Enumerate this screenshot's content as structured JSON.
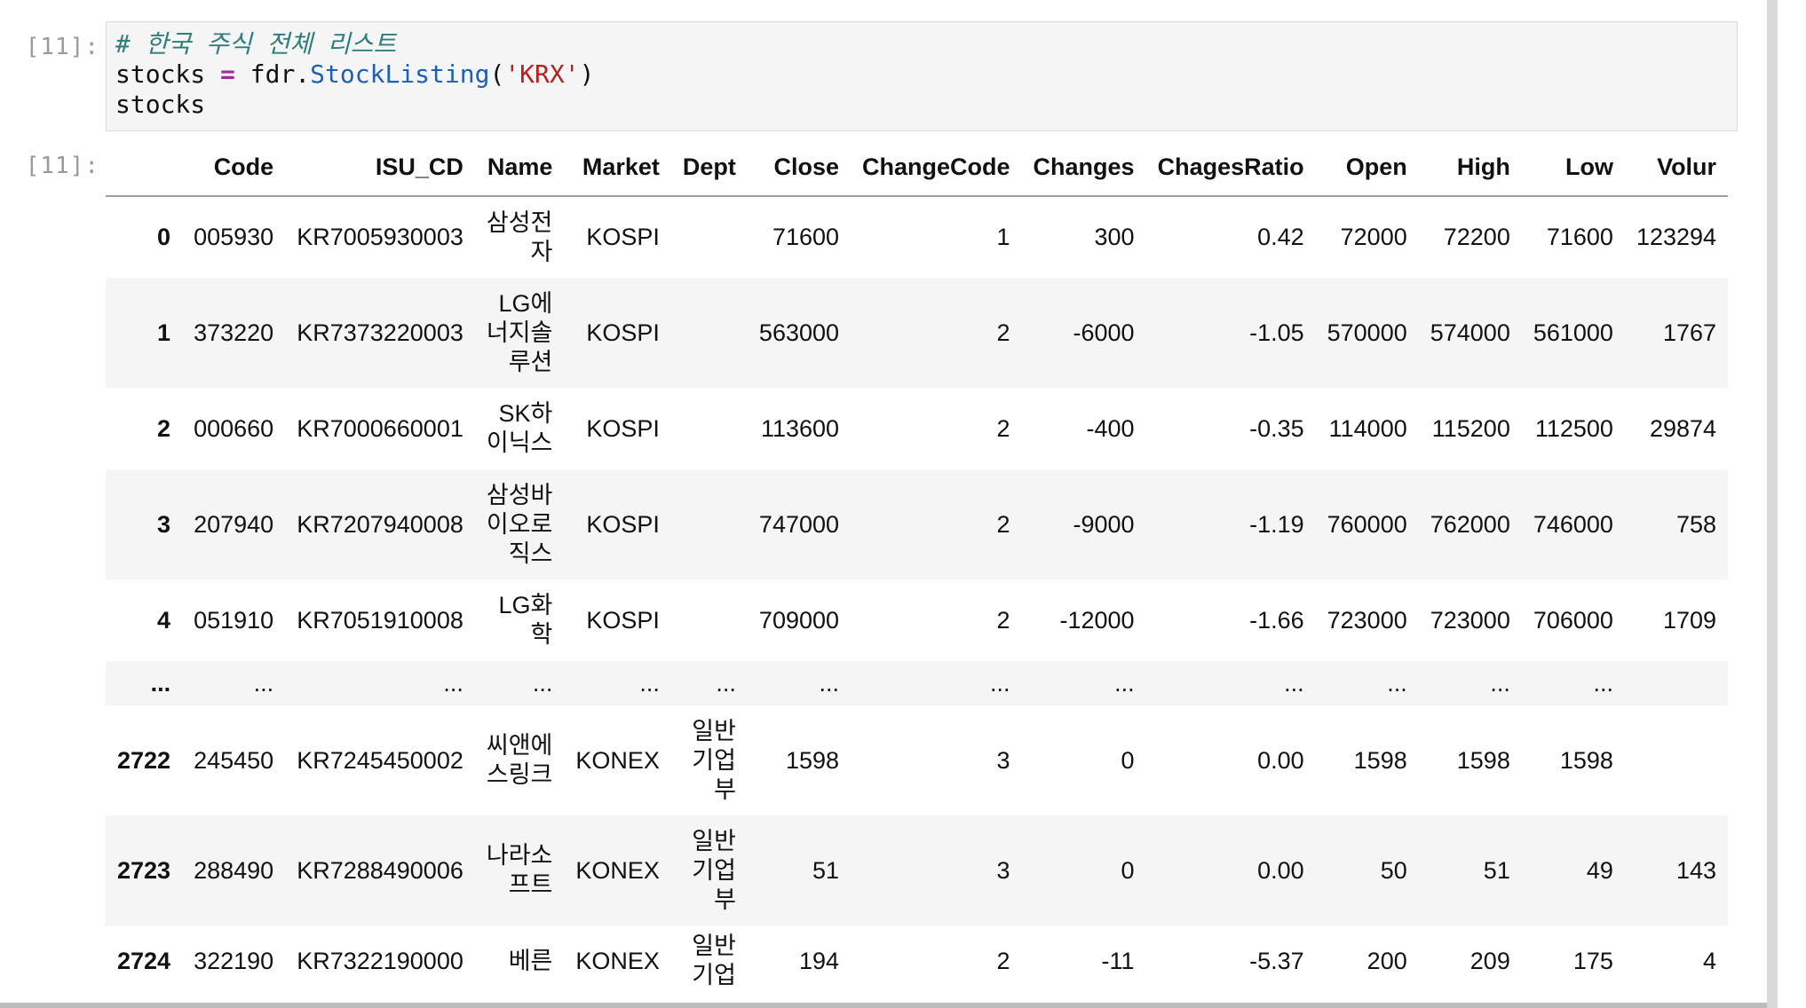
{
  "input_prompt": "[11]:",
  "output_prompt": "[11]:",
  "code_lines": [
    [
      {
        "cls": "c-comment",
        "t": "# 한국 주식 전체 리스트"
      }
    ],
    [
      {
        "cls": "c-name",
        "t": "stocks "
      },
      {
        "cls": "c-op",
        "t": "="
      },
      {
        "cls": "c-name",
        "t": " fdr."
      },
      {
        "cls": "c-func",
        "t": "StockListing"
      },
      {
        "cls": "c-name",
        "t": "("
      },
      {
        "cls": "c-str",
        "t": "'KRX'"
      },
      {
        "cls": "c-name",
        "t": ")"
      }
    ],
    [
      {
        "cls": "c-name",
        "t": "stocks"
      }
    ]
  ],
  "table": {
    "columns": [
      "",
      "Code",
      "ISU_CD",
      "Name",
      "Market",
      "Dept",
      "Close",
      "ChangeCode",
      "Changes",
      "ChagesRatio",
      "Open",
      "High",
      "Low",
      "Volur"
    ],
    "rows": [
      {
        "idx": "0",
        "cells": [
          "005930",
          "KR7005930003",
          [
            "삼성전",
            "자"
          ],
          "KOSPI",
          "",
          "71600",
          "1",
          "300",
          "0.42",
          "72000",
          "72200",
          "71600",
          "123294"
        ]
      },
      {
        "idx": "1",
        "cells": [
          "373220",
          "KR7373220003",
          [
            "LG에",
            "너지솔",
            "루션"
          ],
          "KOSPI",
          "",
          "563000",
          "2",
          "-6000",
          "-1.05",
          "570000",
          "574000",
          "561000",
          "1767"
        ]
      },
      {
        "idx": "2",
        "cells": [
          "000660",
          "KR7000660001",
          [
            "SK하",
            "이닉스"
          ],
          "KOSPI",
          "",
          "113600",
          "2",
          "-400",
          "-0.35",
          "114000",
          "115200",
          "112500",
          "29874"
        ]
      },
      {
        "idx": "3",
        "cells": [
          "207940",
          "KR7207940008",
          [
            "삼성바",
            "이오로",
            "직스"
          ],
          "KOSPI",
          "",
          "747000",
          "2",
          "-9000",
          "-1.19",
          "760000",
          "762000",
          "746000",
          "758"
        ]
      },
      {
        "idx": "4",
        "cells": [
          "051910",
          "KR7051910008",
          [
            "LG화",
            "학"
          ],
          "KOSPI",
          "",
          "709000",
          "2",
          "-12000",
          "-1.66",
          "723000",
          "723000",
          "706000",
          "1709"
        ]
      },
      {
        "idx": "...",
        "cells": [
          "...",
          "...",
          [
            "..."
          ],
          "...",
          "...",
          "...",
          "...",
          "...",
          "...",
          "...",
          "...",
          "...",
          ""
        ]
      },
      {
        "idx": "2722",
        "cells": [
          "245450",
          "KR7245450002",
          [
            "씨앤에",
            "스링크"
          ],
          "KONEX",
          [
            "일반",
            "기업",
            "부"
          ],
          "1598",
          "3",
          "0",
          "0.00",
          "1598",
          "1598",
          "1598",
          ""
        ]
      },
      {
        "idx": "2723",
        "cells": [
          "288490",
          "KR7288490006",
          [
            "나라소",
            "프트"
          ],
          "KONEX",
          [
            "일반",
            "기업",
            "부"
          ],
          "51",
          "3",
          "0",
          "0.00",
          "50",
          "51",
          "49",
          "143"
        ]
      },
      {
        "idx": "2724",
        "cells": [
          "322190",
          "KR7322190000",
          [
            "베른"
          ],
          "KONEX",
          [
            "일반",
            "기업"
          ],
          "194",
          "2",
          "-11",
          "-5.37",
          "200",
          "209",
          "175",
          "4"
        ]
      }
    ]
  }
}
